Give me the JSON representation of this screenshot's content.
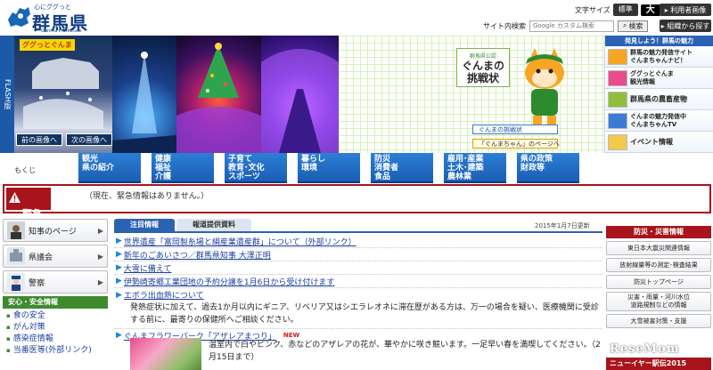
{
  "header": {
    "logo_tagline": "心にググっと",
    "logo_name": "群馬県",
    "logo_sub": "Gunma Prefecture",
    "font_size_label": "文字サイズ",
    "font_standard": "標準",
    "font_large": "大",
    "util_button": "利用者画像",
    "search_label": "サイト内検索",
    "search_placeholder": "Google カスタム検索",
    "search_button": "検索",
    "detail_button": "組織から探す"
  },
  "banner": {
    "flash_tab": "FLASH版",
    "panel1_tag": "ググっとぐんま",
    "prev_button": "前の画像へ",
    "next_button": "次の画像へ",
    "challenge_small": "群馬県公認",
    "challenge_title": "ぐんまの挑戦状",
    "challenge_link": "ぐんまの挑戦状",
    "chan_link": "「ぐんまちゃん」のページへ"
  },
  "promo": {
    "head": "発見しよう！群馬の魅力",
    "items": [
      {
        "text": "群馬の魅力発信サイト\nぐんまちゃんナビ！",
        "icon": "gunmachan-navi-icon"
      },
      {
        "text": "ググっとぐんま\n観光情報",
        "icon": "tourism-icon"
      },
      {
        "text": "群馬県の農畜産物",
        "icon": "farm-products-icon"
      },
      {
        "text": "ぐんまの魅力発信中\nぐんまちゃんTV",
        "icon": "gunmachan-tv-icon"
      },
      {
        "text": "イベント情報",
        "icon": "event-icon"
      }
    ]
  },
  "mokuji": "もくじ",
  "nav": [
    "観光\n県の紹介",
    "健康\n福祉\n介護",
    "子育て\n教育･文化\nスポーツ",
    "暮らし\n環境",
    "防災\n消費者\n食品",
    "雇用･産業\n土木･建築\n農林業",
    "県の政策\n財政等"
  ],
  "emergency": {
    "badge": "緊急\n情報",
    "text": "（現在、緊急情報はありません。）"
  },
  "left": {
    "buttons": [
      {
        "label": "知事のページ",
        "icon": "governor-icon"
      },
      {
        "label": "県議会",
        "icon": "assembly-icon"
      },
      {
        "label": "警察",
        "icon": "police-icon"
      }
    ],
    "safety_head": "安心・安全情報",
    "safety_items": [
      "食の安全",
      "がん対策",
      "感染症情報",
      "当番医等(外部リンク)"
    ]
  },
  "center": {
    "tab_active": "注目情報",
    "tab_inactive": "報道提供資料",
    "date": "2015年1月7日更新",
    "news": [
      "世界遺産「富岡製糸場と絹産業遺産群」について（外部リンク）",
      "新年のごあいさつ／群馬県知事 大澤正明",
      "大雪に備えて",
      "伊勢崎寄郷工業団地の予約分譲を1月6日から受け付けます",
      "エボラ出血熱について"
    ],
    "ebola_body": "発熱症状に加えて、過去1か月以内にギニア、リベリア又はシエラレオネに滞在歴がある方は、万一の場合を疑い、医療機関に受診する前に、最寄りの保健所へご相談ください。",
    "flower_title": "ぐんまフラワーパーク「アザレアまつり」",
    "flower_new": "NEW",
    "flower_body": "温室内で白やピンク、赤などのアザレアの花が、華やかに咲き競います。一足早い春を満喫してください。（2月15日まで）"
  },
  "right": {
    "head": "防災・災害情報",
    "buttons": [
      "東日本大震災関連情報",
      "放射線量等の測定･検査結果",
      "防災トップページ",
      "災害・雨量・河川水位\n道路規制などの情報",
      "大雪被害対策・支援"
    ],
    "newyear": "ニューイヤー駅伝2015"
  },
  "watermark": "ReseMom"
}
